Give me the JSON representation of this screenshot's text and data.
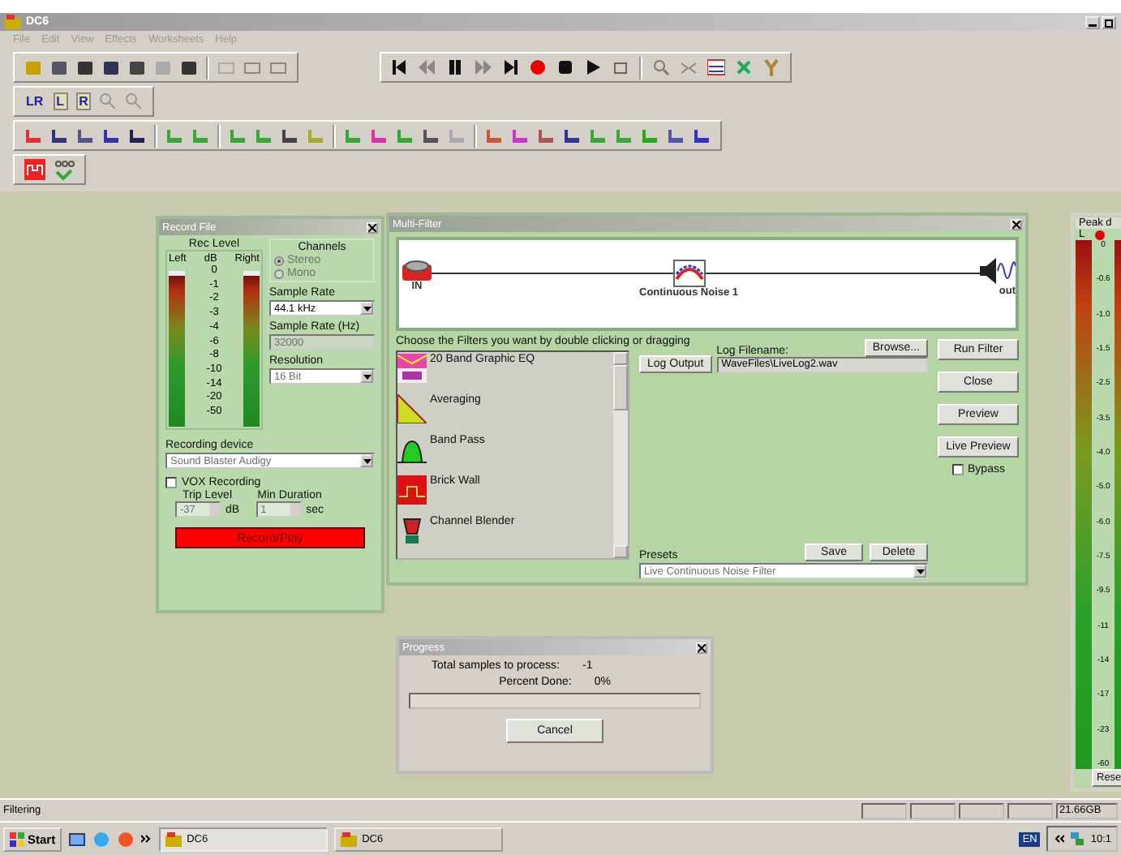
{
  "window": {
    "title": "DC6"
  },
  "menu": [
    "File",
    "Edit",
    "View",
    "Effects",
    "Worksheets",
    "Help"
  ],
  "channel_buttons": [
    "LR",
    "L",
    "R"
  ],
  "record_file": {
    "title": "Record File",
    "rec_level_label": "Rec Level",
    "meter_labels": [
      "Left",
      "dB",
      "Right"
    ],
    "scale": [
      "0",
      "-1",
      "-2",
      "-3",
      "-4",
      "-6",
      "-8",
      "-10",
      "-14",
      "-20",
      "-50"
    ],
    "channels_label": "Channels",
    "channels": [
      {
        "label": "Stereo",
        "selected": true
      },
      {
        "label": "Mono",
        "selected": false
      }
    ],
    "sample_rate_label": "Sample Rate",
    "sample_rate": "44.1 kHz",
    "sample_rate_hz_label": "Sample Rate (Hz)",
    "sample_rate_hz": "32000",
    "resolution_label": "Resolution",
    "resolution": "16 Bit",
    "recording_device_label": "Recording device",
    "recording_device": "Sound Blaster Audigy",
    "vox": {
      "label": "VOX Recording",
      "checked": false
    },
    "trip_level_label": "Trip Level",
    "trip_level": "-37",
    "trip_unit": "dB",
    "min_duration_label": "Min Duration",
    "min_duration": "1",
    "min_unit": "sec",
    "record_button": "Record/Play"
  },
  "multi_filter": {
    "title": "Multi-Filter",
    "in_label": "IN",
    "node_label": "Continuous Noise 1",
    "out_label": "out",
    "instruction": "Choose the Filters you want by double clicking or dragging",
    "filters": [
      "20 Band Graphic EQ",
      "Averaging",
      "Band Pass",
      "Brick Wall",
      "Channel Blender"
    ],
    "log_output": "Log Output",
    "log_filename_label": "Log Filename:",
    "log_filename": "WaveFiles\\LiveLog2.wav",
    "browse": "Browse...",
    "buttons": [
      "Run Filter",
      "Close",
      "Preview",
      "Live Preview"
    ],
    "bypass": {
      "label": "Bypass",
      "checked": false
    },
    "save": "Save",
    "delete": "Delete",
    "presets_label": "Presets",
    "preset": "Live Continuous Noise Filter"
  },
  "progress": {
    "title": "Progress",
    "total_label": "Total samples to process:",
    "total": "-1",
    "percent_label": "Percent Done:",
    "percent": "0%",
    "level": 0,
    "cancel": "Cancel"
  },
  "peak_meter": {
    "title": "Peak d",
    "channel": "L",
    "scale": [
      "0",
      "-0.6",
      "-1.0",
      "-1.5",
      "-2.5",
      "-3.5",
      "-4.0",
      "-5.0",
      "-6.0",
      "-7.5",
      "-9.5",
      "-11",
      "-14",
      "-17",
      "-23",
      "-60"
    ],
    "reset": "Rese"
  },
  "status_bar": {
    "text": "Filtering",
    "disk": "21.66GB"
  },
  "taskbar": {
    "start": "Start",
    "tasks": [
      "DC6",
      "DC6"
    ],
    "language": "EN",
    "clock": "10:1"
  }
}
